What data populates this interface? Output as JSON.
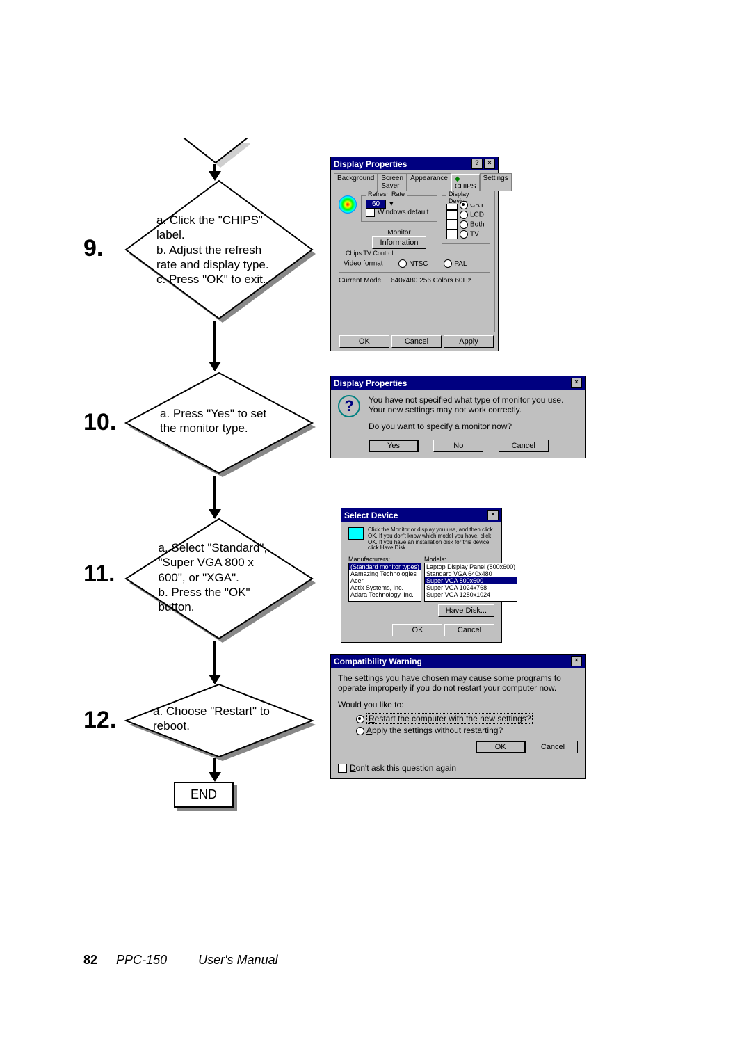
{
  "page_footer": {
    "page_number": "82",
    "model": "PPC-150",
    "title": "User's Manual"
  },
  "steps": {
    "s9": {
      "num": "9.",
      "lines": "a. Click the \"CHIPS\" label.\nb. Adjust the refresh rate and display type.\nc. Press \"OK\" to exit."
    },
    "s10": {
      "num": "10.",
      "lines": "a. Press \"Yes\" to set the monitor type."
    },
    "s11": {
      "num": "11.",
      "lines": "a. Select \"Standard\", \"Super VGA 800 x 600\", or \"XGA\".\nb. Press the \"OK\" button."
    },
    "s12": {
      "num": "12.",
      "lines": "a. Choose \"Restart\" to reboot."
    },
    "end": "END"
  },
  "dlg_display_props": {
    "title": "Display Properties",
    "tabs": [
      "Background",
      "Screen Saver",
      "Appearance",
      "CHIPS",
      "Settings"
    ],
    "active_tab": "CHIPS",
    "groups": {
      "refresh": {
        "title": "Refresh Rate",
        "value": "60",
        "windows_default": "Windows default"
      },
      "display": {
        "title": "Display Device",
        "options": [
          "CRT",
          "LCD",
          "Both",
          "TV"
        ]
      },
      "tv": {
        "title": "Chips TV Control",
        "label": "Video format",
        "options": [
          "NTSC",
          "PAL"
        ]
      },
      "mode": {
        "label": "Current Mode:",
        "value": "640x480 256 Colors 60Hz"
      },
      "info_btn": "Information"
    },
    "buttons": [
      "OK",
      "Cancel",
      "Apply"
    ]
  },
  "dlg_monitor_prompt": {
    "title": "Display Properties",
    "line1": "You have not specified what type of monitor you use. Your new settings may not work correctly.",
    "line2": "Do you want to specify a monitor now?",
    "buttons": {
      "yes": "Yes",
      "no": "No",
      "cancel": "Cancel"
    }
  },
  "dlg_select_device": {
    "title": "Select Device",
    "intro": "Click the Monitor or display you use, and then click OK. If you don't know which model you have, click OK. If you have an installation disk for this device, click Have Disk.",
    "manufacturers_label": "Manufacturers:",
    "models_label": "Models:",
    "manufacturers": [
      "(Standard monitor types)",
      "Aamazing Technologies",
      "Acer",
      "Actix Systems, Inc.",
      "Adara Technology, Inc."
    ],
    "models": [
      "Laptop Display Panel (800x600)",
      "Standard VGA 640x480",
      "Super VGA 800x600",
      "Super VGA 1024x768",
      "Super VGA 1280x1024"
    ],
    "selected_model": "Super VGA 800x600",
    "have_disk": "Have Disk...",
    "buttons": {
      "ok": "OK",
      "cancel": "Cancel"
    }
  },
  "dlg_compat": {
    "title": "Compatibility Warning",
    "line1": "The settings you have chosen may cause some programs to operate improperly if you do not restart your computer now.",
    "prompt": "Would you like to:",
    "opt_restart": "Restart the computer with the new settings?",
    "opt_apply": "Apply the settings without restarting?",
    "checkbox": "Don't ask this question again",
    "buttons": {
      "ok": "OK",
      "cancel": "Cancel"
    }
  }
}
